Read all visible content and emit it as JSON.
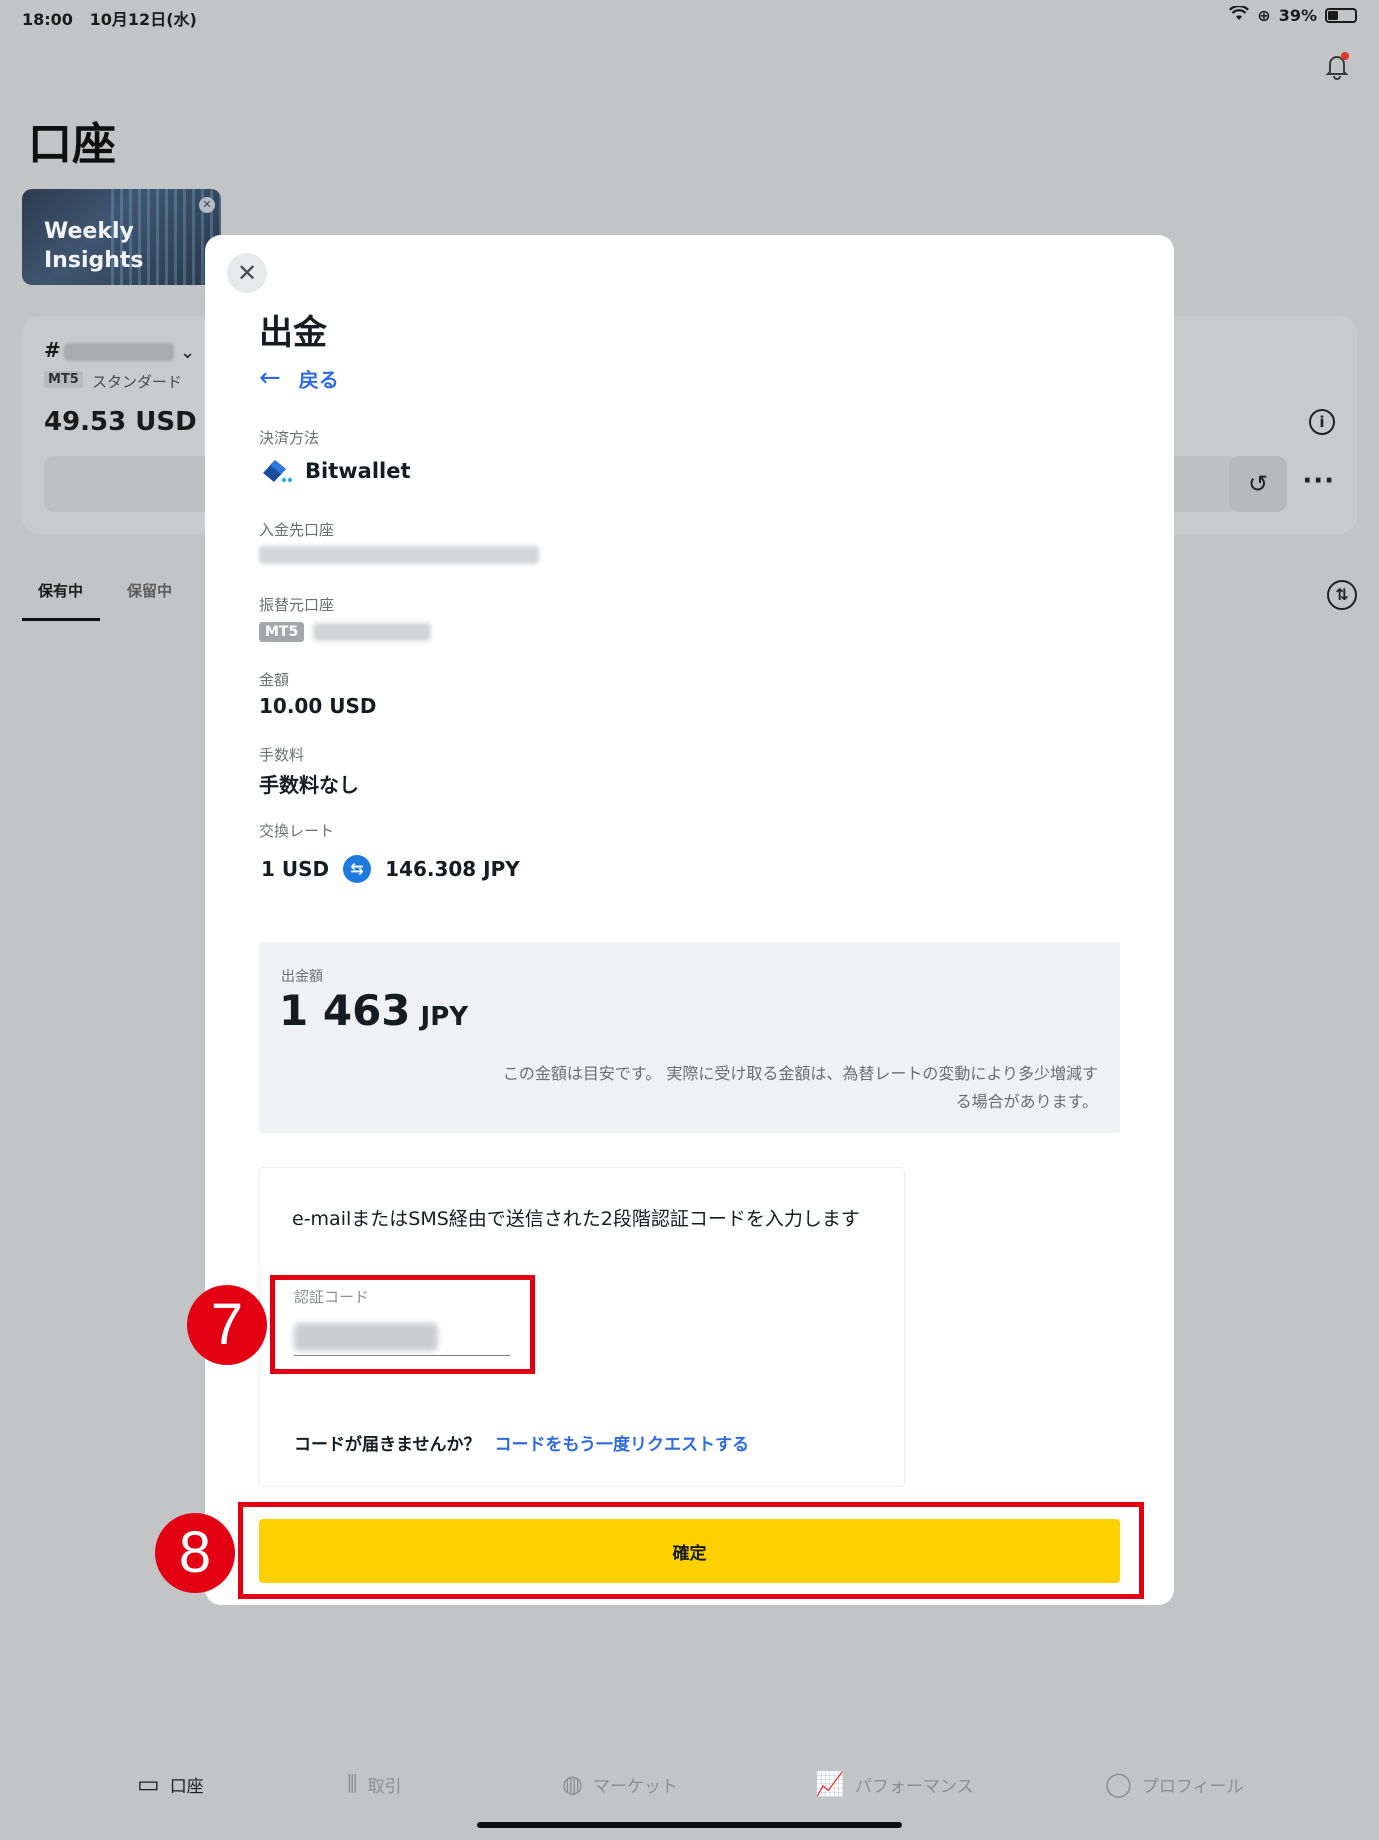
{
  "status_bar": {
    "time": "18:00",
    "date": "10月12日(水)",
    "battery": "39%"
  },
  "page": {
    "title": "口座",
    "insights_card": "Weekly Insights"
  },
  "account": {
    "number_prefix": "#",
    "platform": "MT5",
    "type": "スタンダード",
    "balance": "49.53 USD"
  },
  "tabs": [
    "保有中",
    "保留中"
  ],
  "modal": {
    "title": "出金",
    "back_label": "戻る",
    "payment_method_label": "決済方法",
    "payment_method": "Bitwallet",
    "destination_label": "入金先口座",
    "source_label": "振替元口座",
    "source_platform": "MT5",
    "amount_label": "金額",
    "amount": "10.00 USD",
    "fee_label": "手数料",
    "fee": "手数料なし",
    "rate_label": "交換レート",
    "rate_from": "1 USD",
    "rate_to": "146.308 JPY",
    "withdraw_amount_label": "出金額",
    "withdraw_amount": "1 463",
    "withdraw_currency": "JPY",
    "withdraw_note": "この金額は目安です。 実際に受け取る金額は、為替レートの変動により多少増減する場合があります。",
    "code_instruction": "e-mailまたはSMS経由で送信された2段階認証コードを入力します",
    "code_label": "認証コード",
    "resend_question": "コードが届きませんか？",
    "resend_link": "コードをもう一度リクエストする",
    "confirm_label": "確定"
  },
  "annotations": {
    "step7": "7",
    "step8": "8"
  },
  "bottom_nav": [
    {
      "label": "口座",
      "icon": "card-icon"
    },
    {
      "label": "取引",
      "icon": "chart-bars-icon"
    },
    {
      "label": "マーケット",
      "icon": "globe-icon"
    },
    {
      "label": "パフォーマンス",
      "icon": "performance-icon"
    },
    {
      "label": "プロフィール",
      "icon": "person-icon"
    }
  ],
  "colors": {
    "accent_yellow": "#ffd000",
    "link_blue": "#2f6be0",
    "annotation_red": "#e30012"
  }
}
